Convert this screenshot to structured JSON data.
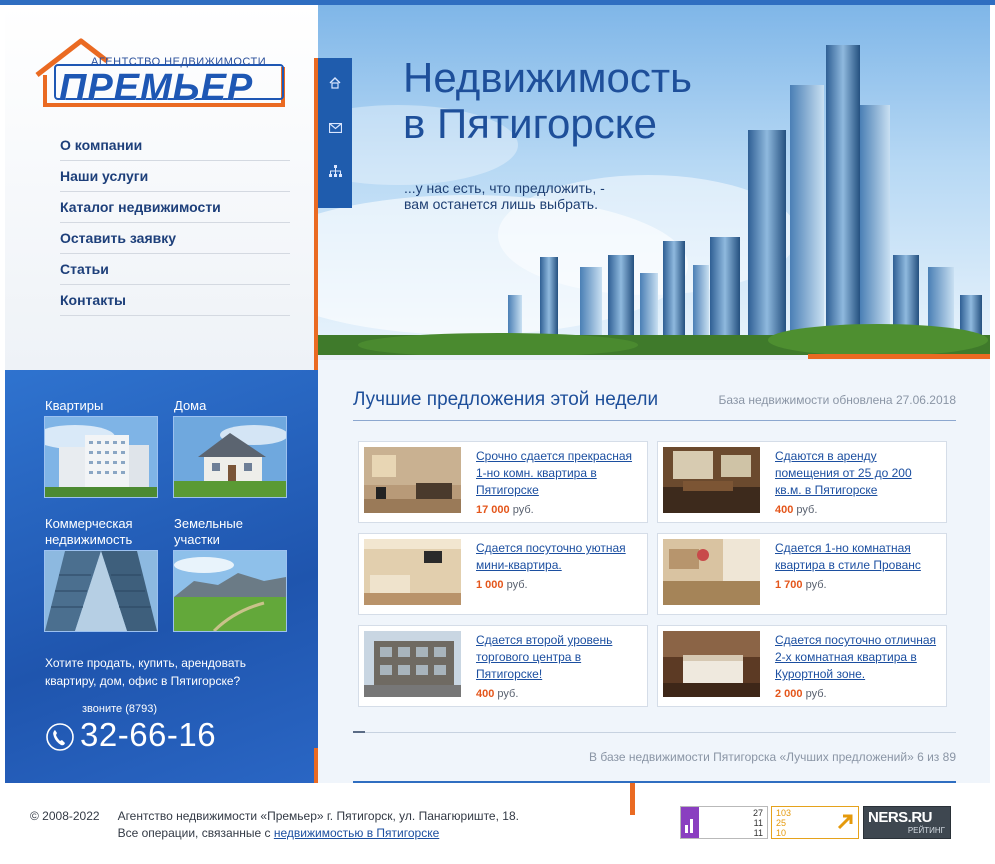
{
  "logo": {
    "subtitle": "АГЕНТСТВО НЕДВИЖИМОСТИ",
    "name": "ПРЕМЬЕР"
  },
  "nav": {
    "items": [
      {
        "label": "О компании"
      },
      {
        "label": "Наши услуги"
      },
      {
        "label": "Каталог недвижимости"
      },
      {
        "label": "Оставить заявку"
      },
      {
        "label": "Статьи"
      },
      {
        "label": "Контакты"
      }
    ]
  },
  "tools": [
    {
      "icon": "home-icon"
    },
    {
      "icon": "mail-icon"
    },
    {
      "icon": "sitemap-icon"
    }
  ],
  "hero": {
    "title_line1": "Недвижимость",
    "title_line2": "в Пятигорске",
    "sub_line1": "...у нас есть, что предложить, -",
    "sub_line2": "вам останется лишь выбрать."
  },
  "categories": [
    {
      "label": "Квартиры"
    },
    {
      "label": "Дома"
    },
    {
      "label_line1": "Коммерческая",
      "label_line2": "недвижимость"
    },
    {
      "label_line1": "Земельные",
      "label_line2": "участки"
    }
  ],
  "cta": {
    "text": "Хотите продать, купить, арендовать квартиру, дом, офис в Пятигорске?",
    "phone_note": "звоните (8793)",
    "phone": "32-66-16"
  },
  "offers": {
    "title": "Лучшие предложения этой недели",
    "updated": "База недвижимости обновлена 27.06.2018",
    "currency": "руб.",
    "items": [
      {
        "title": "Срочно сдается прекрасная 1-но комн. квартира в Пятигорске",
        "price": "17 000"
      },
      {
        "title": "Сдаются в аренду помещения от 25 до 200 кв.м. в Пятигорске",
        "price": "400"
      },
      {
        "title": "Сдается посуточно уютная мини-квартира.",
        "price": "1 000"
      },
      {
        "title": "Сдается 1-но комнатная квартира в стиле Прованс",
        "price": "1 700"
      },
      {
        "title": "Сдается второй уровень торгового центра в Пятигорске!",
        "price": "400"
      },
      {
        "title": "Сдается посуточно отличная 2-х комнатная квартира в Курортной зоне.",
        "price": "2 000"
      }
    ],
    "counter": "В базе недвижимости Пятигорска «Лучших предложений» 6 из 89"
  },
  "footer": {
    "copyright": "© 2008-2022",
    "line1": "Агентство недвижимости «Премьер» г. Пятигорск, ул. Панагюриште, 18.",
    "line2_prefix": "Все операции, связанные с",
    "line2_link": "недвижимостью в Пятигорске"
  },
  "badges": {
    "counter1": [
      "27",
      "11",
      "11"
    ],
    "counter2": [
      "103",
      "25",
      "10"
    ],
    "ners_text": "NERS.RU",
    "ners_sub": "РЕЙТИНГ"
  },
  "colors": {
    "brand_blue": "#1e57b4",
    "accent_orange": "#ea6a22",
    "price_orange": "#e4561b",
    "link_blue": "#1c4fa0"
  }
}
